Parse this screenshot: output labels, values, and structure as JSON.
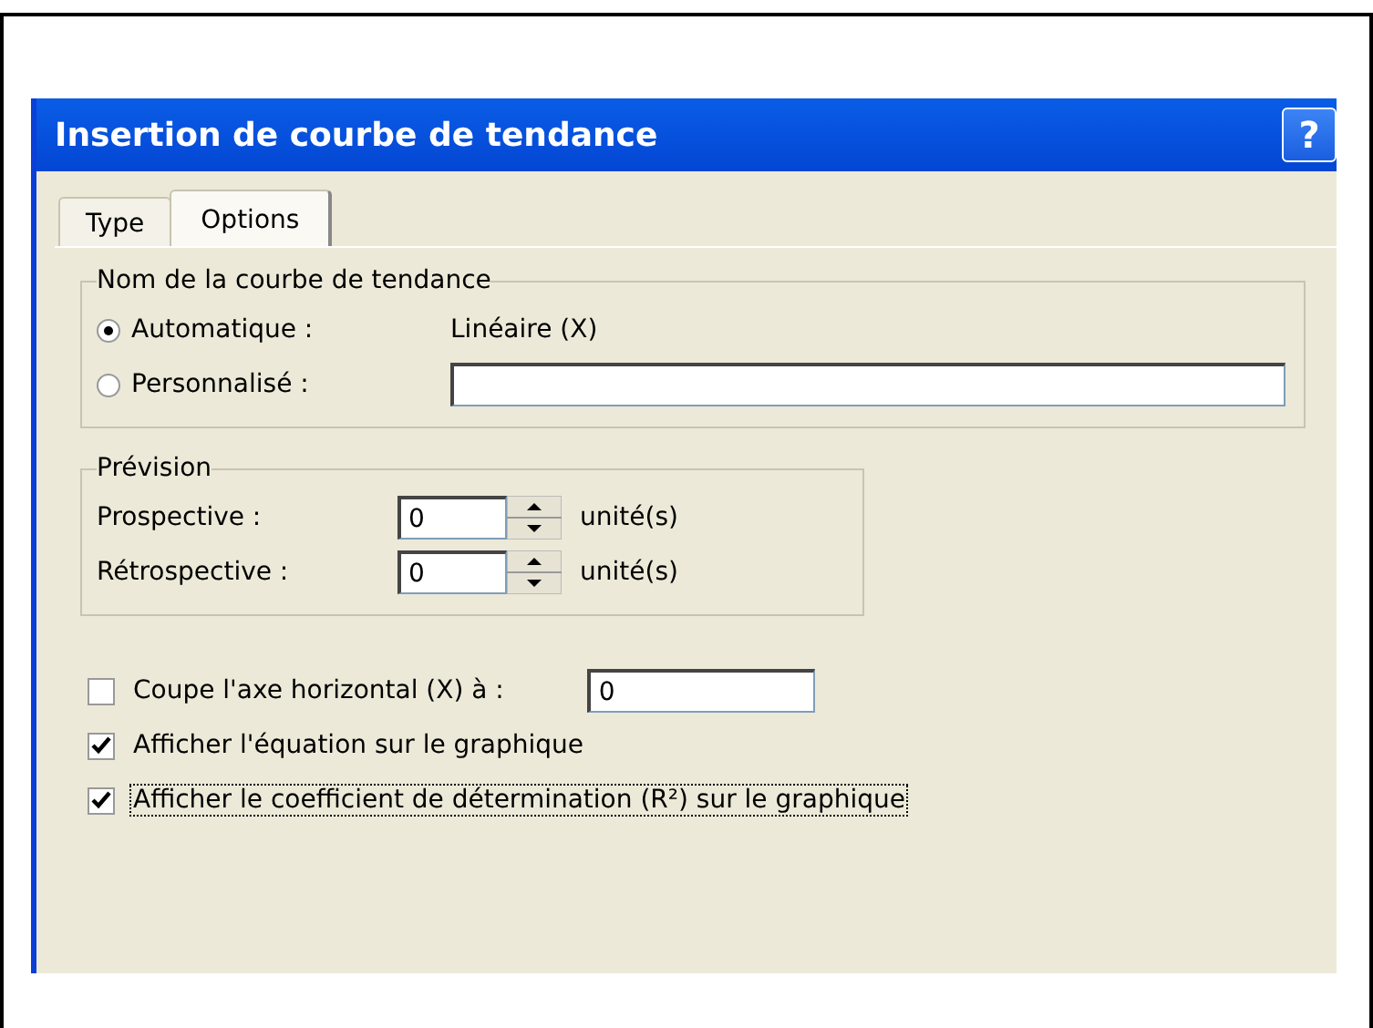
{
  "window": {
    "title": "Insertion de courbe de tendance",
    "help": "?"
  },
  "tabs": [
    {
      "label": "Type",
      "selected": false
    },
    {
      "label": "Options",
      "selected": true
    }
  ],
  "name_group": {
    "title": "Nom de la courbe de tendance",
    "options": [
      {
        "label": "Automatique :",
        "selected": true,
        "value": "Linéaire (X)",
        "kind": "text"
      },
      {
        "label": "Personnalisé :",
        "selected": false,
        "kind": "field"
      }
    ]
  },
  "forecast_group": {
    "title": "Prévision",
    "rows": [
      {
        "label": "Prospective :",
        "value": "0",
        "unit": "unité(s)"
      },
      {
        "label": "Rétrospective :",
        "value": "0",
        "unit": "unité(s)"
      }
    ]
  },
  "checks": [
    {
      "label": "Coupe l'axe horizontal (X) à :",
      "checked": false,
      "value": "0",
      "focused": false
    },
    {
      "label": "Afficher l'équation sur le graphique",
      "checked": true,
      "focused": false
    },
    {
      "label": "Afficher le coefficient de détermination (R²) sur le graphique",
      "checked": true,
      "focused": true
    }
  ]
}
